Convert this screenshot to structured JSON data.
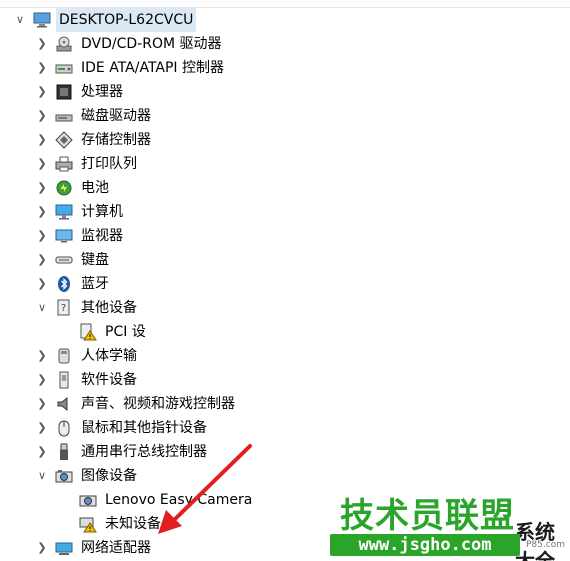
{
  "tree": {
    "root": {
      "label": "DESKTOP-L62CVCU",
      "icon": "computer-icon",
      "expanded": true
    },
    "items": [
      {
        "id": "dvd",
        "label": "DVD/CD-ROM 驱动器",
        "icon": "optical-drive-icon",
        "expanded": false
      },
      {
        "id": "ide",
        "label": "IDE ATA/ATAPI 控制器",
        "icon": "ide-controller-icon",
        "expanded": false
      },
      {
        "id": "cpu",
        "label": "处理器",
        "icon": "processor-icon",
        "expanded": false
      },
      {
        "id": "disk",
        "label": "磁盘驱动器",
        "icon": "disk-drive-icon",
        "expanded": false
      },
      {
        "id": "storage",
        "label": "存储控制器",
        "icon": "storage-controller-icon",
        "expanded": false
      },
      {
        "id": "print",
        "label": "打印队列",
        "icon": "printer-icon",
        "expanded": false
      },
      {
        "id": "battery",
        "label": "电池",
        "icon": "battery-icon",
        "expanded": false
      },
      {
        "id": "computer",
        "label": "计算机",
        "icon": "monitor-icon",
        "expanded": false
      },
      {
        "id": "monitor",
        "label": "监视器",
        "icon": "display-icon",
        "expanded": false
      },
      {
        "id": "keyboard",
        "label": "键盘",
        "icon": "keyboard-icon",
        "expanded": false
      },
      {
        "id": "bluetooth",
        "label": "蓝牙",
        "icon": "bluetooth-icon",
        "expanded": false
      },
      {
        "id": "other",
        "label": "其他设备",
        "icon": "unknown-device-icon",
        "expanded": true,
        "children": [
          {
            "label": "PCI 设",
            "icon": "warning-device-icon"
          }
        ]
      },
      {
        "id": "hid",
        "label": "人体学输",
        "icon": "hid-icon",
        "expanded": false
      },
      {
        "id": "software",
        "label": "软件设备",
        "icon": "software-device-icon",
        "expanded": false
      },
      {
        "id": "audio",
        "label": "声音、视频和游戏控制器",
        "icon": "speaker-icon",
        "expanded": false
      },
      {
        "id": "mouse",
        "label": "鼠标和其他指针设备",
        "icon": "mouse-icon",
        "expanded": false
      },
      {
        "id": "usb",
        "label": "通用串行总线控制器",
        "icon": "usb-icon",
        "expanded": false
      },
      {
        "id": "imaging",
        "label": "图像设备",
        "icon": "camera-icon",
        "expanded": true,
        "children": [
          {
            "label": "Lenovo Easy Camera",
            "icon": "camera-device-icon"
          },
          {
            "label": "未知设备",
            "icon": "warning-camera-icon"
          }
        ]
      },
      {
        "id": "network",
        "label": "网络适配器",
        "icon": "network-adapter-icon",
        "expanded": false
      }
    ]
  },
  "watermark": {
    "logo": "技术员联盟",
    "sub": "系统大全",
    "url": "www.jsgho.com",
    "url2": "P85.com"
  },
  "colors": {
    "selection": "#dbe8f6",
    "annotation_arrow": "#e02020",
    "watermark_green": "#2aa52a"
  }
}
